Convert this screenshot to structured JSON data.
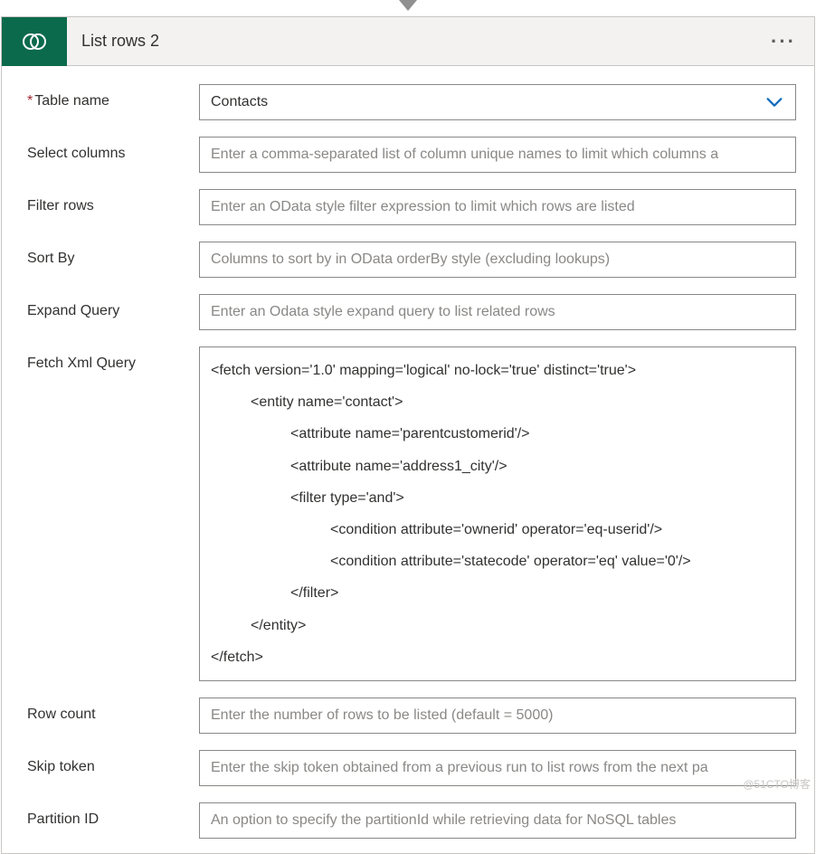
{
  "header": {
    "title": "List rows 2"
  },
  "fields": {
    "tableName": {
      "label": "Table name",
      "required": true,
      "value": "Contacts"
    },
    "selectColumns": {
      "label": "Select columns",
      "placeholder": "Enter a comma-separated list of column unique names to limit which columns a"
    },
    "filterRows": {
      "label": "Filter rows",
      "placeholder": "Enter an OData style filter expression to limit which rows are listed"
    },
    "sortBy": {
      "label": "Sort By",
      "placeholder": "Columns to sort by in OData orderBy style (excluding lookups)"
    },
    "expandQuery": {
      "label": "Expand Query",
      "placeholder": "Enter an Odata style expand query to list related rows"
    },
    "fetchXml": {
      "label": "Fetch Xml Query",
      "lines": [
        "<fetch version='1.0' mapping='logical' no-lock='true' distinct='true'>",
        "<entity name='contact'>",
        "<attribute name='parentcustomerid'/>",
        "<attribute name='address1_city'/>",
        "<filter type='and'>",
        "<condition attribute='ownerid' operator='eq-userid'/>",
        "<condition attribute='statecode' operator='eq' value='0'/>",
        "</filter>",
        "</entity>",
        "</fetch>"
      ]
    },
    "rowCount": {
      "label": "Row count",
      "placeholder": "Enter the number of rows to be listed (default = 5000)"
    },
    "skipToken": {
      "label": "Skip token",
      "placeholder": "Enter the skip token obtained from a previous run to list rows from the next pa"
    },
    "partitionId": {
      "label": "Partition ID",
      "placeholder": "An option to specify the partitionId while retrieving data for NoSQL tables"
    }
  },
  "watermark": "@51CTO博客"
}
